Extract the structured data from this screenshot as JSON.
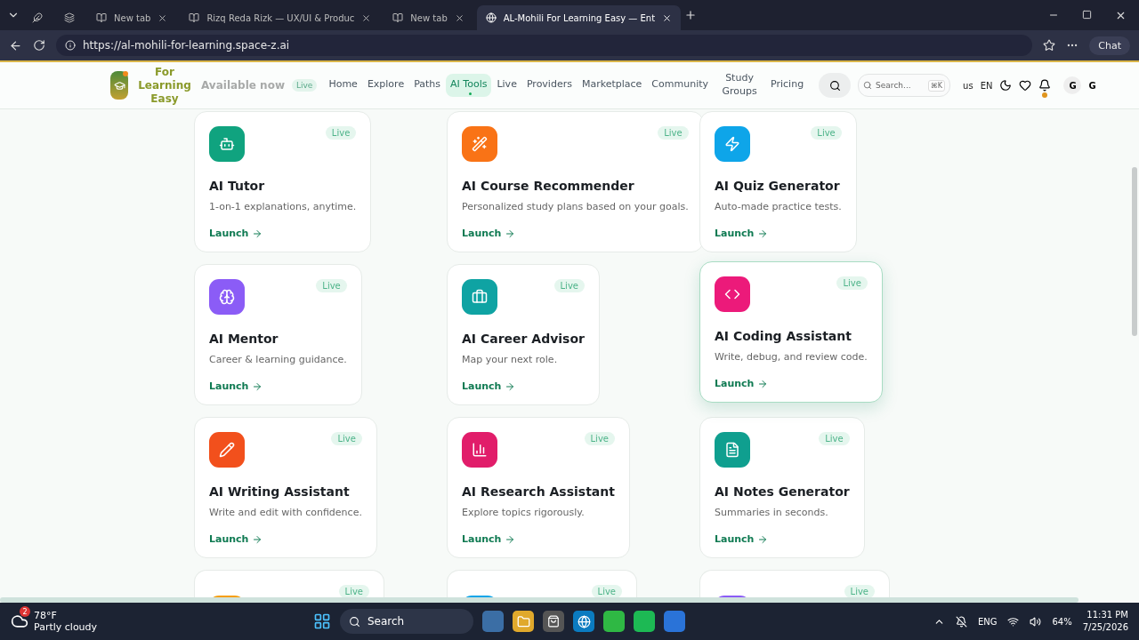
{
  "browser": {
    "tabs": [
      {
        "selected": false
      },
      {
        "selected": false
      },
      {
        "label": "New tab",
        "selected": false
      },
      {
        "label": "Rizq Reda Rizk — UX/UI & Produc",
        "selected": false
      },
      {
        "label": "New tab",
        "selected": false
      },
      {
        "label": "AL-Mohili For Learning Easy — Ent",
        "selected": true
      }
    ],
    "address": "https://al-mohili-for-learning.space-z.ai",
    "chat": "Chat"
  },
  "header": {
    "logo_text": "For Learning Easy",
    "announcement": "Available now",
    "announcement_badge": "Live",
    "nav": [
      {
        "label": "Home",
        "selected": false
      },
      {
        "label": "Explore",
        "selected": false
      },
      {
        "label": "Paths",
        "selected": false
      },
      {
        "label": "AI Tools",
        "selected": true
      },
      {
        "label": "Live",
        "selected": false
      },
      {
        "label": "Providers",
        "selected": false
      },
      {
        "label": "Marketplace",
        "selected": false
      },
      {
        "label": "Community",
        "selected": false
      },
      {
        "label": "Study Groups",
        "selected": false
      },
      {
        "label": "Pricing",
        "selected": false
      }
    ],
    "search": {
      "placeholder": "Search...",
      "shortcut": "⌘K"
    },
    "region": "us",
    "language": "EN",
    "notification_dot": true,
    "avatar": "G",
    "user": "G"
  },
  "tools": [
    {
      "title": "AI Tutor",
      "description": "1-on-1 explanations, anytime.",
      "badge": "Live",
      "action": "Launch",
      "color": "#10a37f",
      "highlighted": false
    },
    {
      "title": "AI Course Recommender",
      "description": "Personalized study plans based on your goals.",
      "badge": "Live",
      "action": "Launch",
      "color": "#f97316",
      "highlighted": false
    },
    {
      "title": "AI Quiz Generator",
      "description": "Auto-made practice tests.",
      "badge": "Live",
      "action": "Launch",
      "color": "#0ea5e9",
      "highlighted": false
    },
    {
      "title": "AI Mentor",
      "description": "Career & learning guidance.",
      "badge": "Live",
      "action": "Launch",
      "color": "#8b5cf6",
      "highlighted": false
    },
    {
      "title": "AI Career Advisor",
      "description": "Map your next role.",
      "badge": "Live",
      "action": "Launch",
      "color": "#0fa3a3",
      "highlighted": false
    },
    {
      "title": "AI Coding Assistant",
      "description": "Write, debug, and review code.",
      "badge": "Live",
      "action": "Launch",
      "color": "#ec1a7a",
      "highlighted": true
    },
    {
      "title": "AI Writing Assistant",
      "description": "Write and edit with confidence.",
      "badge": "Live",
      "action": "Launch",
      "color": "#f2501c",
      "highlighted": false
    },
    {
      "title": "AI Research Assistant",
      "description": "Explore topics rigorously.",
      "badge": "Live",
      "action": "Launch",
      "color": "#e11d6a",
      "highlighted": false
    },
    {
      "title": "AI Notes Generator",
      "description": "Summaries in seconds.",
      "badge": "Live",
      "action": "Launch",
      "color": "#0f9f8f",
      "highlighted": false
    }
  ],
  "partial_tools": [
    {
      "badge": "Live",
      "color": "#f59e0b"
    },
    {
      "badge": "Live",
      "color": "#0ea5e9"
    },
    {
      "badge": "Live",
      "color": "#8b5cf6"
    }
  ],
  "taskbar": {
    "temperature": "78°F",
    "weather": "Partly cloudy",
    "weather_badge": "2",
    "search": "Search",
    "language": "ENG",
    "battery": "64%",
    "time": "11:31 PM",
    "date": "7/25/2026"
  }
}
